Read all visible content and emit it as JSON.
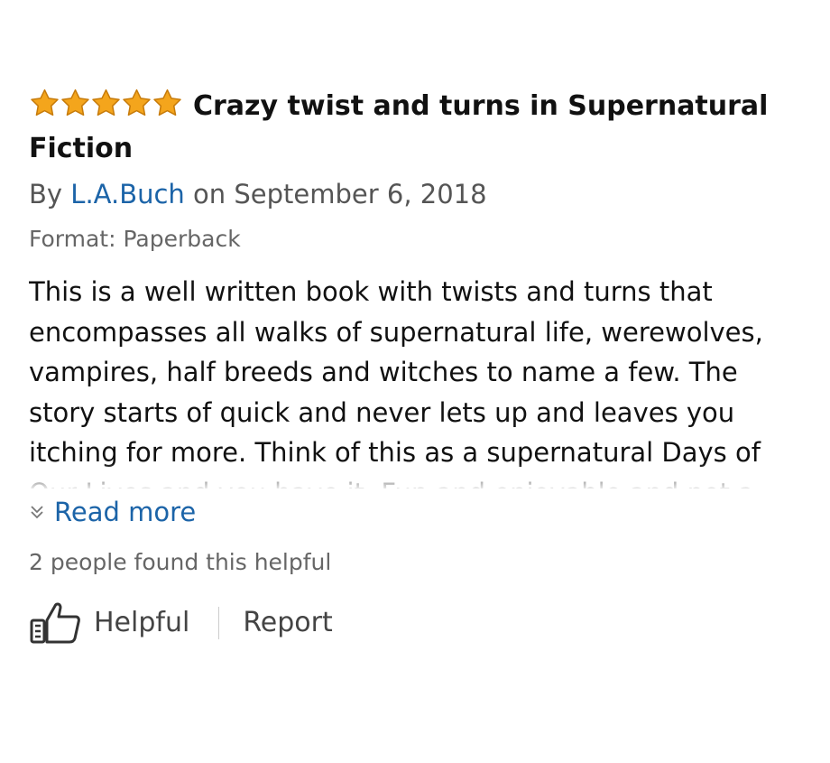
{
  "review": {
    "rating": 5,
    "rating_max": 5,
    "star_color": "#f4a51c",
    "title": "Crazy twist and turns in Supernatural Fiction",
    "by_prefix": "By",
    "author": "L.A.Buch",
    "date": "on September 6, 2018",
    "format": "Format: Paperback",
    "body": "This is a well written book with twists and turns that encompasses all walks of supernatural life, werewolves, vampires, half breeds and witches to name a few. The story starts of quick and never lets up and leaves you itching for more. Think of this as a supernatural Days of Our Lives and you have it. Fun and enjoyable and not a",
    "read_more": "Read more",
    "helpful_count": "2 people found this helpful",
    "helpful_label": "Helpful",
    "report_label": "Report",
    "link_color": "#1c64a8"
  }
}
